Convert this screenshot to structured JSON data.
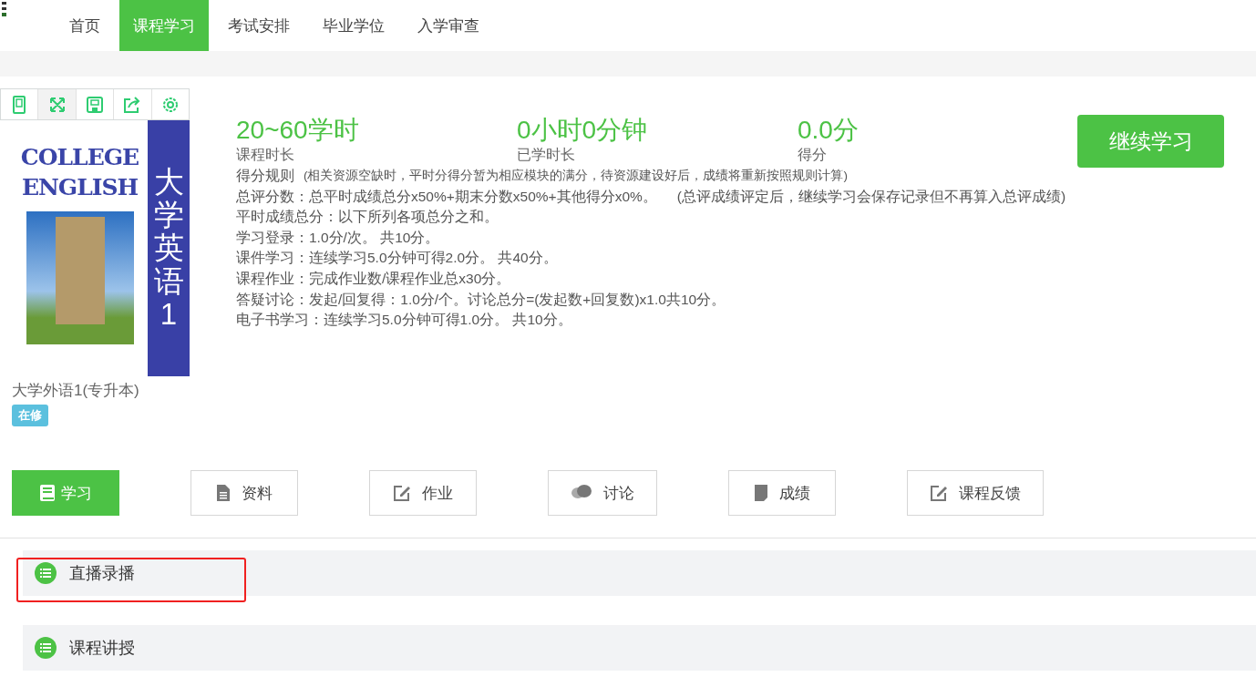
{
  "nav": {
    "items": [
      {
        "label": "首页",
        "selected": false
      },
      {
        "label": "课程学习",
        "selected": true
      },
      {
        "label": "考试安排",
        "selected": false
      },
      {
        "label": "毕业学位",
        "selected": false
      },
      {
        "label": "入学审查",
        "selected": false
      }
    ]
  },
  "course": {
    "cover_title": "COLLEGE ENGLISH",
    "cover_side_title": "大学英语1",
    "name": "大学外语1(专升本)",
    "status": "在修"
  },
  "stats": [
    {
      "value": "20~60学时",
      "label": "课程时长"
    },
    {
      "value": "0小时0分钟",
      "label": "已学时长"
    },
    {
      "value": "0.0分",
      "label": "得分"
    }
  ],
  "continue_button": "继续学习",
  "rules": [
    {
      "text": "得分规则",
      "note": "(相关资源空缺时，平时分得分暂为相应模块的满分，待资源建设好后，成绩将重新按照规则计算)"
    },
    {
      "text": "总评分数：总平时成绩总分x50%+期末分数x50%+其他得分x0%。",
      "note": "(总评成绩评定后，继续学习会保存记录但不再算入总评成绩)"
    },
    {
      "text": "平时成绩总分：以下所列各项总分之和。"
    },
    {
      "text": "学习登录：1.0分/次。 共10分。"
    },
    {
      "text": "课件学习：连续学习5.0分钟可得2.0分。 共40分。"
    },
    {
      "text": "课程作业：完成作业数/课程作业总x30分。"
    },
    {
      "text": "答疑讨论：发起/回复得：1.0分/个。讨论总分=(发起数+回复数)x1.0共10分。"
    },
    {
      "text": "电子书学习：连续学习5.0分钟可得1.0分。 共10分。"
    }
  ],
  "tabs": [
    {
      "label": "学习",
      "kind": "book",
      "selected": true
    },
    {
      "label": "资料",
      "kind": "doc",
      "selected": false
    },
    {
      "label": "作业",
      "kind": "edit",
      "selected": false
    },
    {
      "label": "讨论",
      "kind": "chat",
      "selected": false
    },
    {
      "label": "成绩",
      "kind": "page",
      "selected": false
    },
    {
      "label": "课程反馈",
      "kind": "edit",
      "selected": false
    }
  ],
  "sections": [
    {
      "title": "直播录播",
      "highlighted": true
    },
    {
      "title": "课程讲授",
      "highlighted": false
    }
  ]
}
